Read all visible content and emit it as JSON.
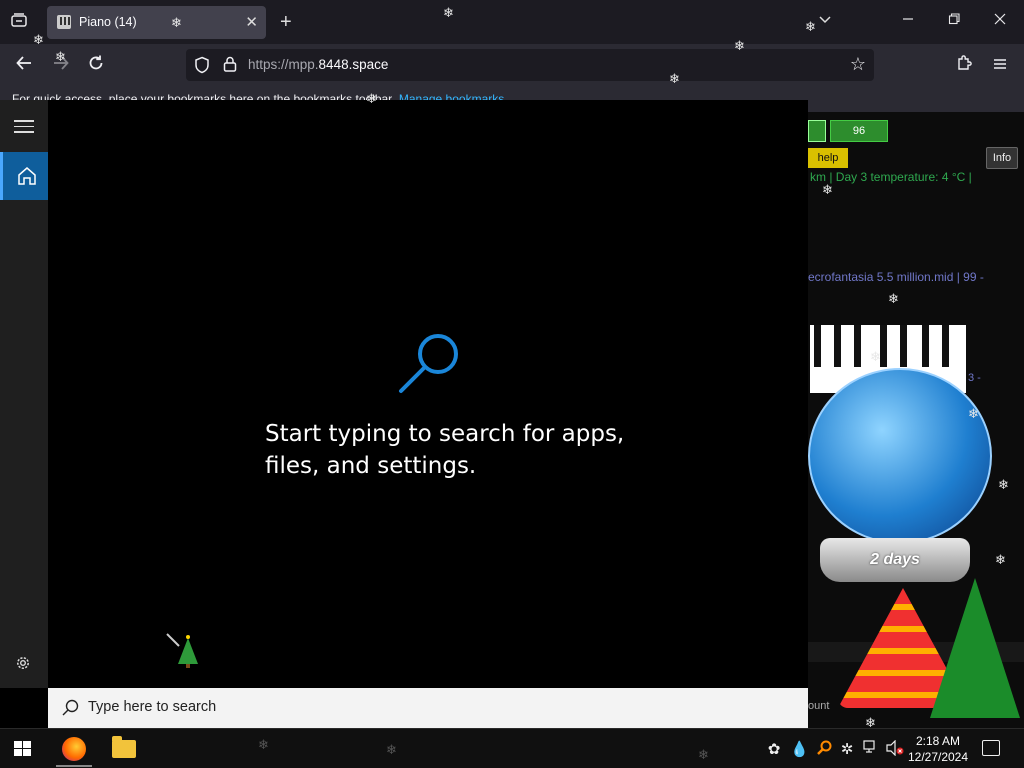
{
  "browser": {
    "tab": {
      "title": "Piano (14)"
    },
    "url": {
      "host_prefix": "https://mpp.",
      "host_main": "8448.space"
    },
    "bookmarks_bar": {
      "text": "For quick access, place your bookmarks here on the bookmarks toolbar.",
      "link": "Manage bookmarks"
    }
  },
  "page": {
    "count_value": "96",
    "help_label": "help",
    "info_label": "Info",
    "temperature_text": "km | Day 3 temperature: 4 °C |",
    "track_text": "ecrofantasia 5.5 million.mid | 99 -",
    "side_number": "3 -",
    "globe_label": "2 days",
    "count_label": "ount"
  },
  "start_menu": {
    "hint": "Start typing to search for apps, files, and settings.",
    "search_placeholder": "Type here to search"
  },
  "taskbar": {
    "time": "2:18 AM",
    "date": "12/27/2024"
  },
  "colors": {
    "accent": "#0f5e9c",
    "page_green": "#2d8d2d",
    "page_yellow": "#d9c000",
    "track_text": "#7077c8",
    "temperature_text": "#2fa84f"
  },
  "icons": [
    "tab-list-icon",
    "piano-favicon",
    "close-tab-icon",
    "new-tab-icon",
    "list-tabs-icon",
    "minimize-icon",
    "restore-icon",
    "close-window-icon",
    "back-icon",
    "forward-icon",
    "reload-icon",
    "shield-icon",
    "lock-icon",
    "bookmark-star-icon",
    "extensions-icon",
    "app-menu-icon",
    "hamburger-icon",
    "home-icon",
    "settings-gear-icon",
    "search-illustration-icon",
    "search-icon",
    "windows-start-icon",
    "firefox-icon",
    "file-explorer-icon",
    "tray-app-icon",
    "water-drop-icon",
    "search-tray-icon",
    "brightness-icon",
    "network-icon",
    "volume-muted-icon",
    "notification-icon",
    "snowflake-icon",
    "christmas-tree-cursor-icon"
  ]
}
